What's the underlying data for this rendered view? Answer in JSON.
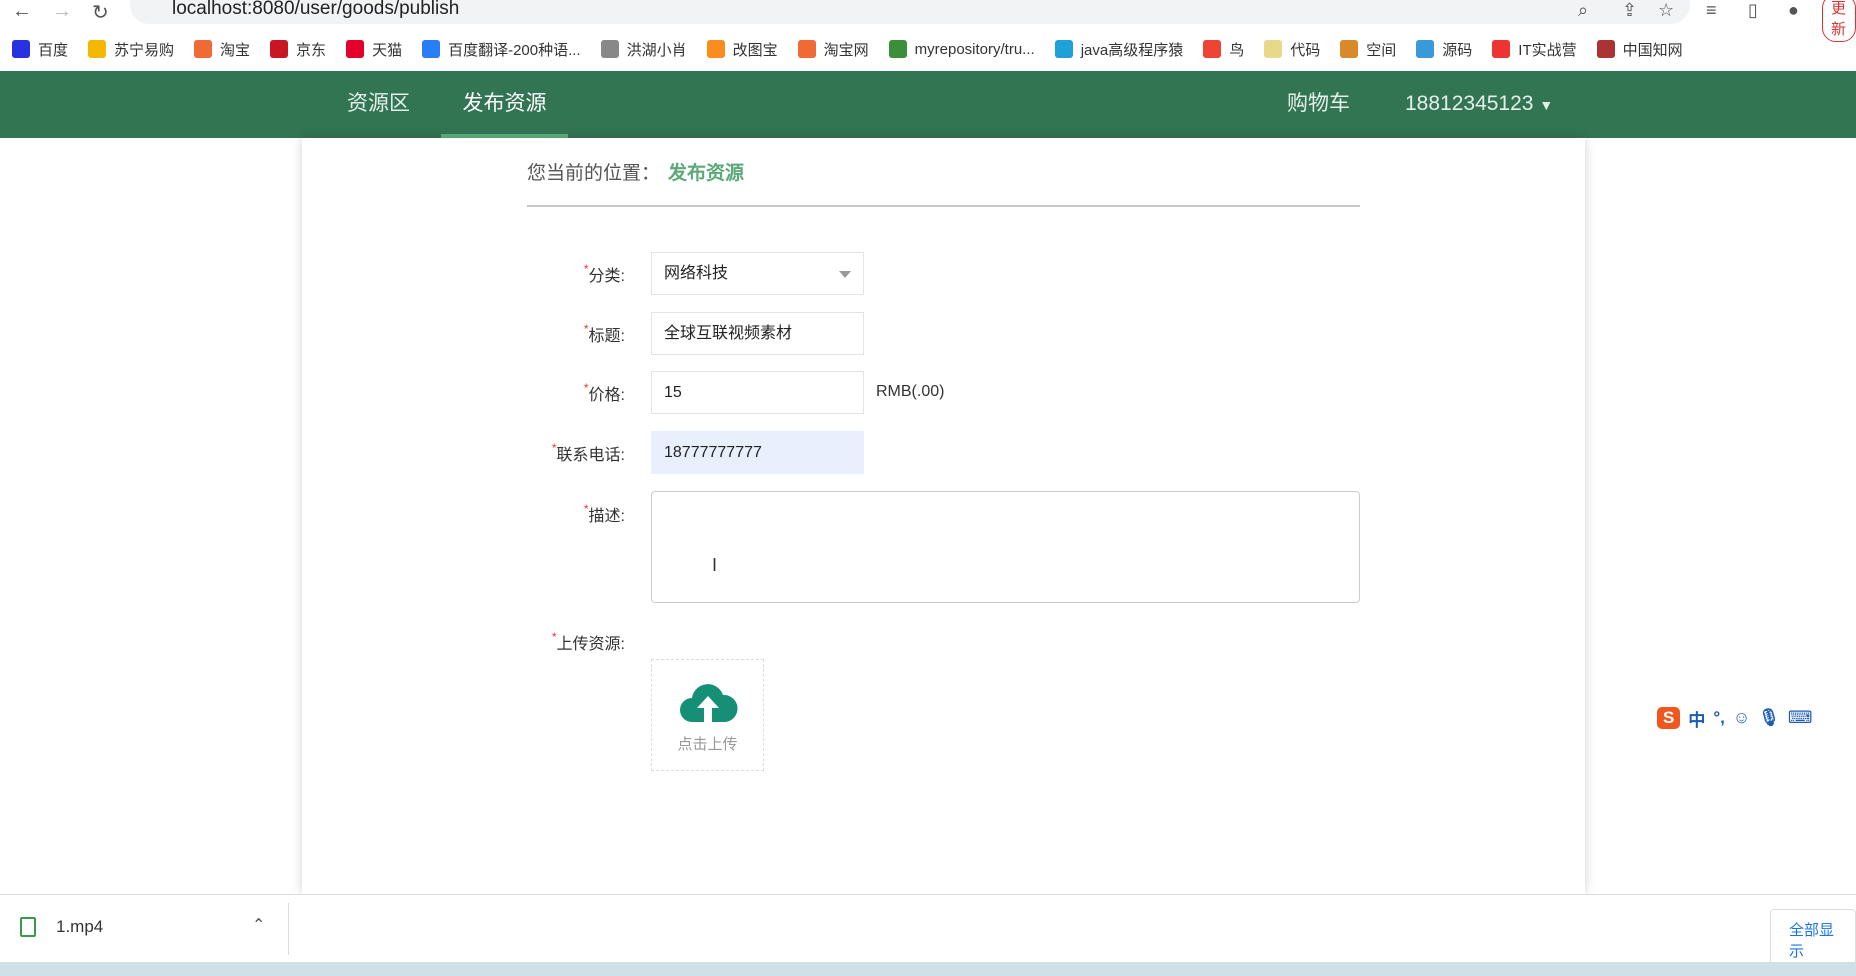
{
  "browser": {
    "url": "localhost:8080/user/goods/publish",
    "update_label": "更新"
  },
  "bookmarks": [
    {
      "label": "百度",
      "color": "#2932e1"
    },
    {
      "label": "苏宁易购",
      "color": "#f5b800"
    },
    {
      "label": "淘宝",
      "color": "#f06a35"
    },
    {
      "label": "京东",
      "color": "#c91623"
    },
    {
      "label": "天猫",
      "color": "#e4002b"
    },
    {
      "label": "百度翻译-200种语...",
      "color": "#2a7ef5"
    },
    {
      "label": "洪湖小肖",
      "color": "#888"
    },
    {
      "label": "改图宝",
      "color": "#fb8c1e"
    },
    {
      "label": "淘宝网",
      "color": "#f06a35"
    },
    {
      "label": "myrepository/tru...",
      "color": "#3b8f3b"
    },
    {
      "label": "java高级程序猿",
      "color": "#20a0d8"
    },
    {
      "label": "鸟",
      "color": "#e43"
    },
    {
      "label": "代码",
      "color": "#e8d98a"
    },
    {
      "label": "空间",
      "color": "#d88a2a"
    },
    {
      "label": "源码",
      "color": "#3a9ad9"
    },
    {
      "label": "IT实战营",
      "color": "#e33"
    },
    {
      "label": "中国知网",
      "color": "#a33"
    }
  ],
  "nav": {
    "items": [
      "资源区",
      "发布资源"
    ],
    "cart": "购物车",
    "user": "18812345123"
  },
  "breadcrumb": {
    "prefix": "您当前的位置：",
    "current": "发布资源"
  },
  "form": {
    "category": {
      "label": "分类:",
      "value": "网络科技"
    },
    "title": {
      "label": "标题:",
      "value": "全球互联视频素材"
    },
    "price": {
      "label": "价格:",
      "value": "15",
      "unit": "RMB(.00)"
    },
    "phone": {
      "label": "联系电话:",
      "value": "18777777777"
    },
    "description": {
      "label": "描述:",
      "value": ""
    },
    "upload": {
      "label": "上传资源:",
      "button": "点击上传"
    },
    "required_mark": "*"
  },
  "downloads": {
    "file": "1.mp4",
    "show_all": "全部显示"
  },
  "ime": {
    "mode": "中",
    "punct": "°,"
  },
  "colors": {
    "nav_bg": "#327552",
    "accent": "#5ba978",
    "upload_icon": "#159077"
  }
}
